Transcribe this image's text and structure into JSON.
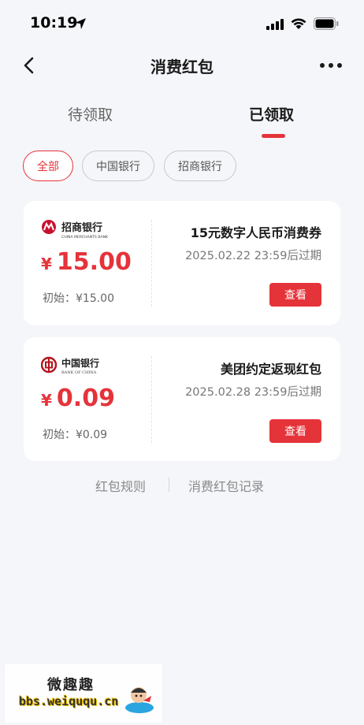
{
  "status_bar": {
    "time": "10:19"
  },
  "nav": {
    "title": "消费红包"
  },
  "tabs": [
    {
      "label": "待领取",
      "active": false
    },
    {
      "label": "已领取",
      "active": true
    }
  ],
  "filters": [
    {
      "label": "全部",
      "selected": true
    },
    {
      "label": "中国银行",
      "selected": false
    },
    {
      "label": "招商银行",
      "selected": false
    }
  ],
  "coupons": [
    {
      "bank_logo_text": "招商银行",
      "bank_logo_sub": "CHINA MERCHANTS BANK",
      "currency": "¥",
      "amount": "15.00",
      "initial": "初始：¥15.00",
      "name": "15元数字人民币消费券",
      "expiry": "2025.02.22 23:59后过期",
      "button": "查看"
    },
    {
      "bank_logo_text": "中国银行",
      "bank_logo_sub": "BANK OF CHINA",
      "currency": "¥",
      "amount": "0.09",
      "initial": "初始：¥0.09",
      "name": "美团约定返现红包",
      "expiry": "2025.02.28 23:59后过期",
      "button": "查看"
    }
  ],
  "footer": {
    "rules": "红包规则",
    "records": "消费红包记录"
  },
  "watermark": {
    "title": "微趣趣",
    "url": "bbs.weiququ.cn"
  },
  "colors": {
    "accent": "#e5333a",
    "background": "#f5f6f9"
  },
  "icons": [
    "location-arrow-icon",
    "signal-icon",
    "wifi-icon",
    "battery-icon",
    "back-chevron-icon",
    "more-dots-icon"
  ]
}
